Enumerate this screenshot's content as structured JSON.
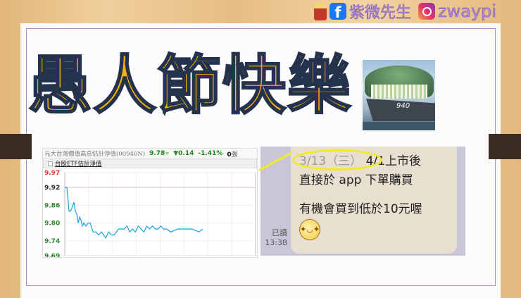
{
  "brand": {
    "name": "紫微先生",
    "handle": "zwaypi",
    "icons": [
      "mascot-icon",
      "facebook-icon",
      "instagram-icon"
    ]
  },
  "title": "愚人節快樂",
  "image": {
    "ship_number": "940"
  },
  "widget": {
    "name": "元大台灣價值高息估計淨值(00940N)",
    "price": "9.78",
    "flat_sign": "=",
    "change": "▼0.14",
    "pct": "-1.41%",
    "volume_num": "0",
    "volume_unit": "張",
    "checkbox_label": "台股ETF估計淨值"
  },
  "chart_data": {
    "type": "line",
    "title": "台股ETF估計淨值",
    "xlabel": "",
    "ylabel": "",
    "ylim": [
      9.69,
      9.97
    ],
    "xlim": [
      0,
      270
    ],
    "yticks": [
      "9.97",
      "9.92",
      "9.86",
      "9.80",
      "9.74",
      "9.69"
    ],
    "reference": 9.92,
    "grid": true,
    "series": [
      {
        "name": "估計淨值",
        "color": "#2aa6de",
        "x": [
          0,
          3,
          6,
          8,
          10,
          13,
          15,
          17,
          19,
          21,
          23,
          25,
          27,
          30,
          33,
          36,
          40,
          44,
          48,
          52,
          58,
          62,
          66,
          70,
          76,
          80,
          84,
          88,
          92,
          96,
          100,
          104,
          108,
          112,
          116,
          120,
          124,
          128,
          132,
          136,
          140,
          144,
          150,
          160,
          170,
          180,
          190,
          195
        ],
        "y": [
          9.92,
          9.92,
          9.84,
          9.84,
          9.85,
          9.87,
          9.84,
          9.83,
          9.8,
          9.82,
          9.81,
          9.79,
          9.8,
          9.79,
          9.8,
          9.8,
          9.77,
          9.77,
          9.76,
          9.77,
          9.75,
          9.77,
          9.76,
          9.76,
          9.78,
          9.78,
          9.78,
          9.79,
          9.77,
          9.78,
          9.77,
          9.79,
          9.78,
          9.77,
          9.79,
          9.78,
          9.79,
          9.78,
          9.78,
          9.79,
          9.78,
          9.78,
          9.77,
          9.78,
          9.78,
          9.78,
          9.77,
          9.78
        ]
      }
    ]
  },
  "chat": {
    "line1_date": "3/13（三）",
    "line1_rest": "4/1上市後",
    "line2": "直接於 app 下單購買",
    "line3": "有機會買到低於10元喔",
    "emoji": "✦◡✦",
    "read": "已讀",
    "time": "13:38"
  },
  "colors": {
    "title": "#f7b500",
    "title_outline": "#25324d",
    "up_down": "#1a8a1a",
    "line": "#2aa6de",
    "highlight": "#f2ea26"
  }
}
